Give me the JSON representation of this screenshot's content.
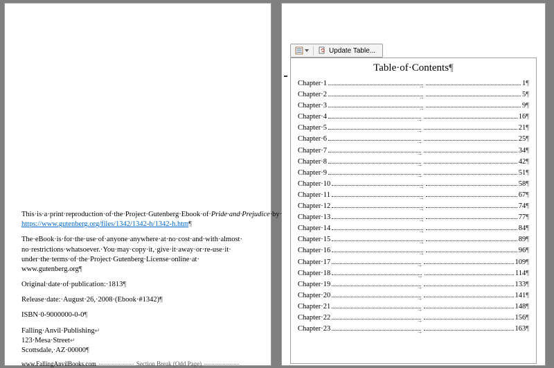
{
  "left": {
    "para1_pre": "This·is·a·print·reproduction·of·the·Project·Gutenberg·Ebook·of·",
    "para1_ital": "Pride·and·Prejudice",
    "para1_post": "·by·Jane·Austen,·available·at·",
    "para1_link": "https://www.gutenberg.org/files/1342/1342-h/1342-h.htm",
    "para2_l1": "The·eBook·is·for·the·use·of·anyone·anywhere·at·no·cost·and·with·almost·",
    "para2_l2": "no·restrictions·whatsoever.·You·may·copy·it,·give·it·away·or·re-use·it·",
    "para2_l3": "under·the·terms·of·the·Project·Gutenberg·License·online·at·",
    "para2_l4": "www.gutenberg.org",
    "orig_pub": "Original·date·of·publication:·1813",
    "release": "Release·date:·August·26,·2008·(Ebook·#1342)",
    "isbn": "ISBN·0-9000000-0-0",
    "pub_name": "Falling·Anvil·Publishing",
    "pub_addr1": "123·Mesa·Street",
    "pub_addr2": "Scottsdale,·AZ·00000",
    "pub_url": "www.FallingAnvilBooks.com",
    "section_break": "Section Break (Odd Page)"
  },
  "toolbar": {
    "update_label": "Update Table..."
  },
  "toc": {
    "title": "Table·of·Contents",
    "rows": [
      {
        "label": "Chapter·1",
        "page": "1"
      },
      {
        "label": "Chapter·2",
        "page": "5"
      },
      {
        "label": "Chapter·3",
        "page": "9"
      },
      {
        "label": "Chapter·4",
        "page": "16"
      },
      {
        "label": "Chapter·5",
        "page": "21"
      },
      {
        "label": "Chapter·6",
        "page": "25"
      },
      {
        "label": "Chapter·7",
        "page": "34"
      },
      {
        "label": "Chapter·8",
        "page": "42"
      },
      {
        "label": "Chapter·9",
        "page": "51"
      },
      {
        "label": "Chapter·10",
        "page": "58"
      },
      {
        "label": "Chapter·11",
        "page": "67"
      },
      {
        "label": "Chapter·12",
        "page": "74"
      },
      {
        "label": "Chapter·13",
        "page": "77"
      },
      {
        "label": "Chapter·14",
        "page": "84"
      },
      {
        "label": "Chapter·15",
        "page": "89"
      },
      {
        "label": "Chapter·16",
        "page": "96"
      },
      {
        "label": "Chapter·17",
        "page": "109"
      },
      {
        "label": "Chapter·18",
        "page": "114"
      },
      {
        "label": "Chapter·19",
        "page": "133"
      },
      {
        "label": "Chapter·20",
        "page": "141"
      },
      {
        "label": "Chapter·21",
        "page": "148"
      },
      {
        "label": "Chapter·22",
        "page": "156"
      },
      {
        "label": "Chapter·23",
        "page": "163"
      }
    ]
  }
}
